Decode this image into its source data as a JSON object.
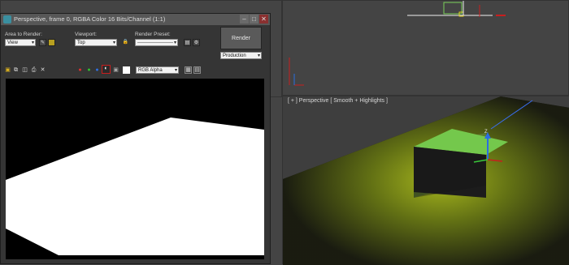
{
  "viewports": {
    "perspective_label": "[ + ] Perspective [ Smooth + Highlights ]"
  },
  "render_window": {
    "title": "Perspective, frame 0, RGBA Color 16 Bits/Channel (1:1)",
    "area_to_render": {
      "label": "Area to Render:",
      "value": "View"
    },
    "viewport": {
      "label": "Viewport:",
      "value": "Top"
    },
    "render_preset": {
      "label": "Render Preset:",
      "value": "----------------------"
    },
    "render_button": "Render",
    "production_value": "Production",
    "channel_value": "RGB Alpha",
    "window_buttons": {
      "minimize": "–",
      "maximize": "□",
      "close": "✕"
    }
  },
  "colors": {
    "viewport_bg": "#444444",
    "accent_red": "#c81e1e",
    "ground_glow": "#8a9a1a",
    "box_green": "#6fcc4e",
    "gizmo_blue": "#2a6ee0"
  }
}
